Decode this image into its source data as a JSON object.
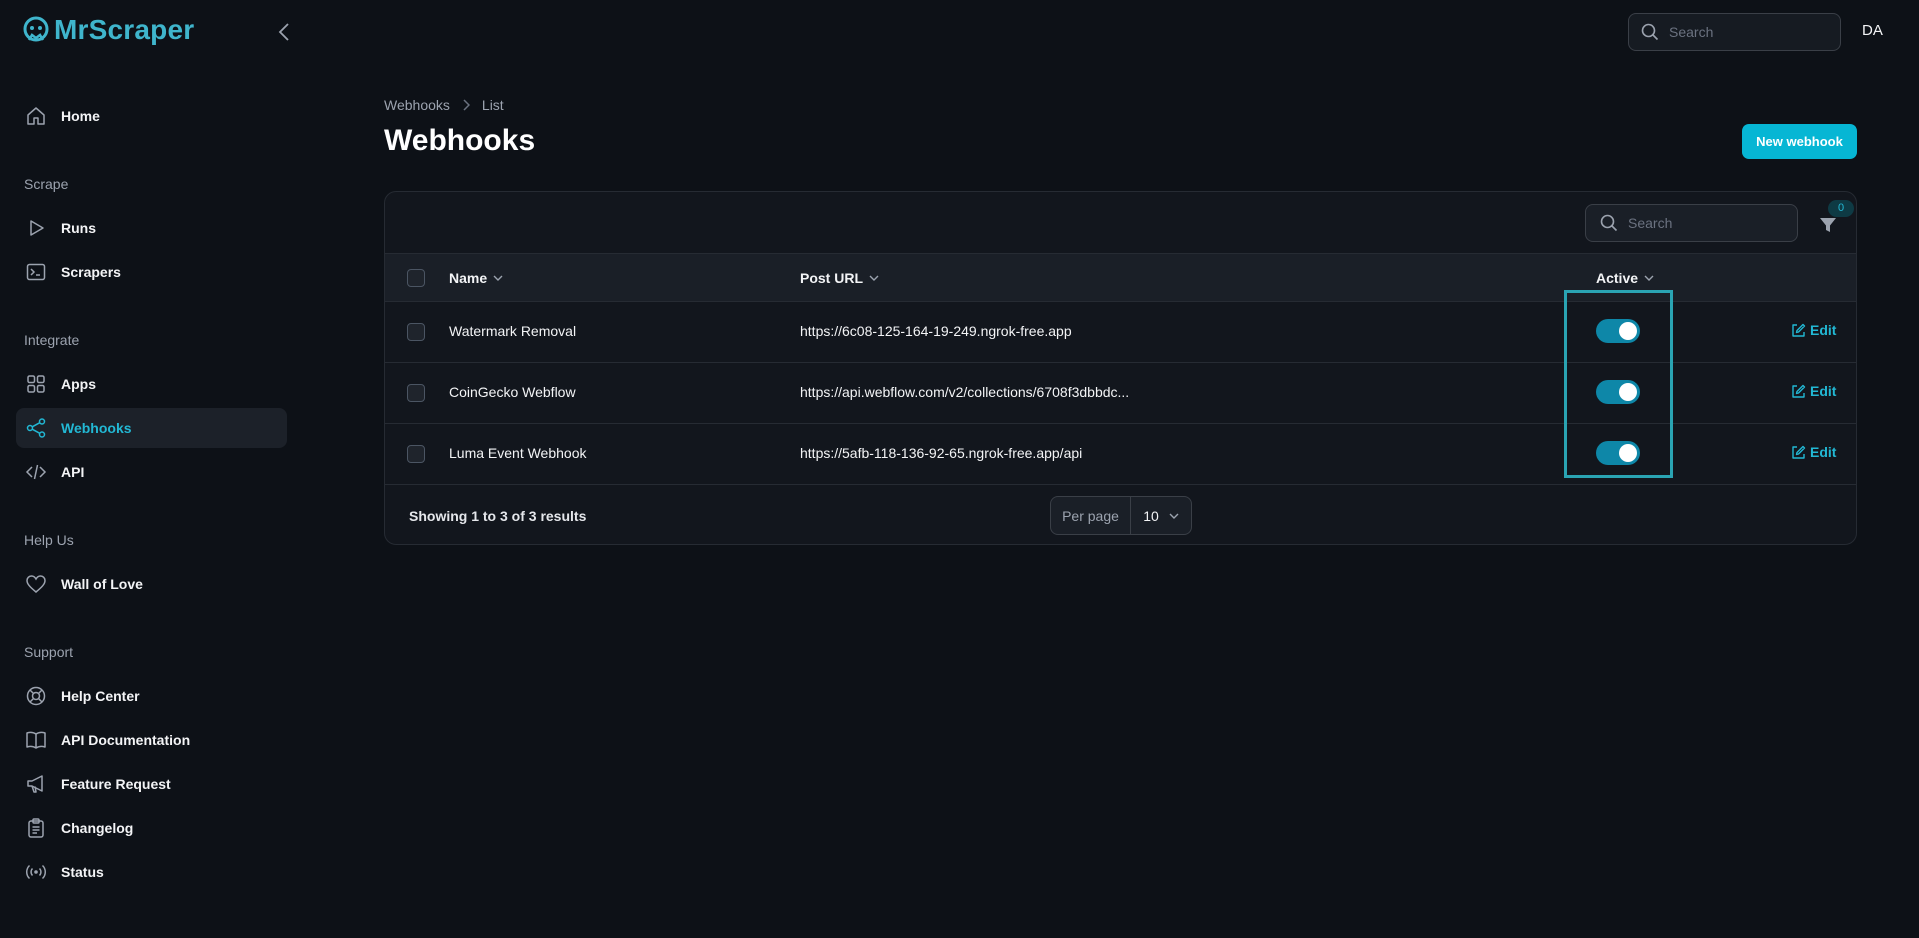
{
  "app": {
    "brand": "MrScraper",
    "accent_color": "#22b8d4",
    "button_color": "#06b6d4"
  },
  "topbar": {
    "search_placeholder": "Search",
    "user_initials": "DA"
  },
  "sidebar": {
    "home": {
      "label": "Home",
      "icon": "home-icon"
    },
    "groups": {
      "scrape": "Scrape",
      "integrate": "Integrate",
      "help_us": "Help Us",
      "support": "Support"
    },
    "items": {
      "runs": {
        "label": "Runs",
        "icon": "play-icon"
      },
      "scrapers": {
        "label": "Scrapers",
        "icon": "terminal-icon"
      },
      "apps": {
        "label": "Apps",
        "icon": "grid-icon"
      },
      "webhooks": {
        "label": "Webhooks",
        "icon": "share-icon",
        "active": true
      },
      "api": {
        "label": "API",
        "icon": "code-icon"
      },
      "wall_of_love": {
        "label": "Wall of Love",
        "icon": "heart-icon"
      },
      "help_center": {
        "label": "Help Center",
        "icon": "lifebuoy-icon"
      },
      "api_documentation": {
        "label": "API Documentation",
        "icon": "book-icon"
      },
      "feature_request": {
        "label": "Feature Request",
        "icon": "megaphone-icon"
      },
      "changelog": {
        "label": "Changelog",
        "icon": "clipboard-icon"
      },
      "status": {
        "label": "Status",
        "icon": "broadcast-icon"
      }
    }
  },
  "main": {
    "breadcrumb": [
      "Webhooks",
      "List"
    ],
    "title": "Webhooks",
    "new_button": "New webhook",
    "table": {
      "search_placeholder": "Search",
      "filter_count": "0",
      "columns": {
        "name": "Name",
        "post_url": "Post URL",
        "active": "Active"
      },
      "rows": [
        {
          "name": "Watermark Removal",
          "post_url": "https://6c08-125-164-19-249.ngrok-free.app",
          "active": true,
          "action": "Edit"
        },
        {
          "name": "CoinGecko Webflow",
          "post_url": "https://api.webflow.com/v2/collections/6708f3dbbdc...",
          "active": true,
          "action": "Edit"
        },
        {
          "name": "Luma Event Webhook",
          "post_url": "https://5afb-118-136-92-65.ngrok-free.app/api",
          "active": true,
          "action": "Edit"
        }
      ],
      "footer": {
        "summary": "Showing 1 to 3 of 3 results",
        "per_page_label": "Per page",
        "per_page_value": "10"
      }
    }
  }
}
